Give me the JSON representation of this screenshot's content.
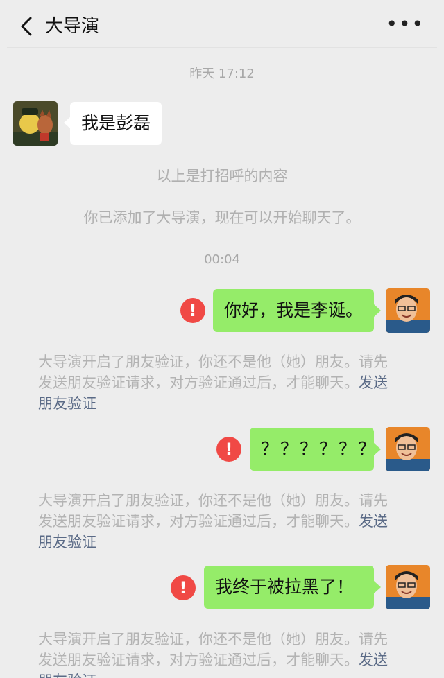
{
  "header": {
    "title": "大导演",
    "more_label": "•••",
    "back_icon": "chevron-left-icon"
  },
  "messages": {
    "time_1": "昨天 17:12",
    "incoming_1": "我是彭磊",
    "sys_1": "以上是打招呼的内容",
    "sys_2": "你已添加了大导演，现在可以开始聊天了。",
    "time_2": "00:04",
    "outgoing_1": "你好，我是李诞。",
    "outgoing_2": "？？？？？？",
    "outgoing_3": "我终于被拉黑了！",
    "error_mark": "!"
  },
  "notice": {
    "line1": "大导演开启了朋友验证，你还不是他（她）朋友。请先",
    "line2": "发送朋友验证请求，对方验证通过后，才能聊天。",
    "link_part1": "发送",
    "link_part2": "朋友验证"
  },
  "colors": {
    "background": "#ededed",
    "bubble_outgoing": "#95ec69",
    "bubble_incoming": "#ffffff",
    "error": "#f04945",
    "link": "#5a6a86"
  }
}
